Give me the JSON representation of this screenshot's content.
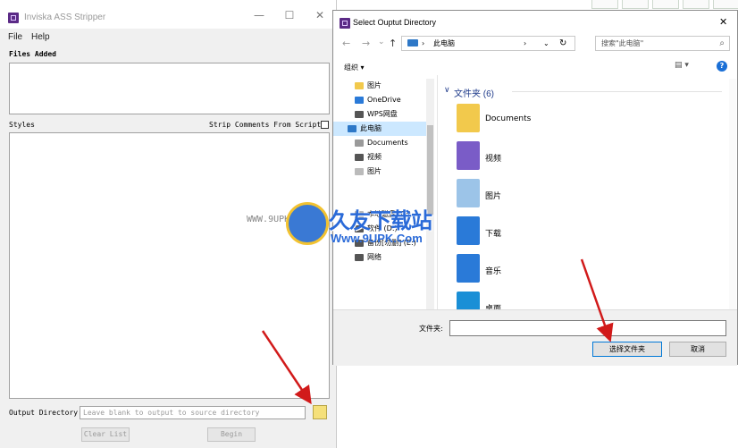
{
  "app": {
    "title": "Inviska ASS Stripper",
    "win_min": "—",
    "win_max": "☐",
    "win_close": "✕",
    "menu": [
      "File",
      "Help"
    ],
    "files_added_label": "Files Added",
    "styles_label": "Styles",
    "strip_comments_label": "Strip Comments From Scripts",
    "output_dir_label": "Output Directory:",
    "output_dir_placeholder": "Leave blank to output to source directory",
    "clear_list_label": "Clear List",
    "begin_label": "Begin"
  },
  "dialog": {
    "title": "Select Ouptut Directory",
    "close": "✕",
    "nav": {
      "back": "←",
      "forward": "→",
      "dropdown": "⌄",
      "up": "↑"
    },
    "address": "此电脑",
    "address_sep": "›",
    "refresh": "↻",
    "search_placeholder": "搜索\"此电脑\"",
    "search_icon": "⌕",
    "organize_label": "组织 ▾",
    "view_label": "▤ ▾",
    "help_label": "?",
    "nav_items": [
      {
        "label": "图片",
        "icon": "folder-icon",
        "color": "#f2c94c"
      },
      {
        "label": "OneDrive",
        "icon": "cloud-icon",
        "color": "#2a7ad8"
      },
      {
        "label": "WPS网盘",
        "icon": "cloud-outline-icon",
        "color": "#555555"
      },
      {
        "label": "此电脑",
        "icon": "pc-icon",
        "color": "#2e78c7"
      },
      {
        "label": "Documents",
        "icon": "document-icon",
        "color": "#9a9a9a"
      },
      {
        "label": "视频",
        "icon": "video-icon",
        "color": "#555555"
      },
      {
        "label": "图片",
        "icon": "image-icon",
        "color": "#bbbbbb"
      },
      {
        "label": "",
        "icon": "blank-icon",
        "color": "#ffffff"
      },
      {
        "label": "",
        "icon": "blank-icon",
        "color": "#ffffff"
      },
      {
        "label": "本地磁盘 (C:)",
        "icon": "drive-icon",
        "color": "#bbbbbb"
      },
      {
        "label": "软件 (D:)",
        "icon": "drive-icon",
        "color": "#555555"
      },
      {
        "label": "备份[勿删] (E:)",
        "icon": "drive-icon",
        "color": "#555555"
      },
      {
        "label": "网络",
        "icon": "network-icon",
        "color": "#555555"
      }
    ],
    "group_header": "文件夹 (6)",
    "group_chevron": "∨",
    "folders": [
      {
        "label": "Documents",
        "icon": "documents-folder-icon",
        "color": "#f2c94c"
      },
      {
        "label": "视频",
        "icon": "videos-folder-icon",
        "color": "#7a5cc7"
      },
      {
        "label": "图片",
        "icon": "pictures-folder-icon",
        "color": "#9cc4e8"
      },
      {
        "label": "下载",
        "icon": "downloads-folder-icon",
        "color": "#2a7ad8"
      },
      {
        "label": "音乐",
        "icon": "music-folder-icon",
        "color": "#2a7ad8"
      },
      {
        "label": "桌面",
        "icon": "desktop-folder-icon",
        "color": "#1a8fd6"
      }
    ],
    "filename_label": "文件夹:",
    "filename_value": "",
    "select_button": "选择文件夹",
    "cancel_button": "取消"
  },
  "watermark": {
    "left_text": "WWW.9UPK.COM",
    "brand": "久友下载站",
    "url": "Www.9UPK.Com"
  },
  "colors": {
    "accent_blue": "#0078d7",
    "arrow_red": "#d11a1a"
  }
}
